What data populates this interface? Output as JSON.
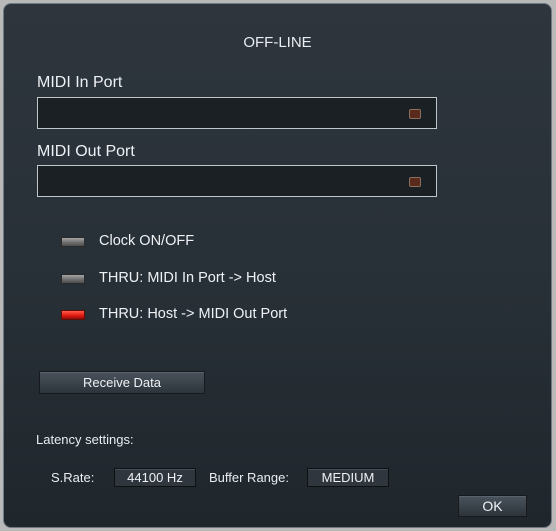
{
  "dialog": {
    "title": "OFF-LINE"
  },
  "midi_in": {
    "label": "MIDI In Port",
    "value": ""
  },
  "midi_out": {
    "label": "MIDI Out Port",
    "value": ""
  },
  "toggles": [
    {
      "label": "Clock ON/OFF",
      "state": "off"
    },
    {
      "label": "THRU: MIDI In Port -> Host",
      "state": "off"
    },
    {
      "label": "THRU: Host -> MIDI Out Port",
      "state": "on"
    }
  ],
  "receive_button": {
    "label": "Receive Data"
  },
  "latency": {
    "heading": "Latency settings:",
    "srate_label": "S.Rate:",
    "srate_value": "44100 Hz",
    "buffer_label": "Buffer Range:",
    "buffer_value": "MEDIUM"
  },
  "ok_button": {
    "label": "OK"
  },
  "colors": {
    "led_on": "#e11b12",
    "led_off": "#7a7a7a",
    "panel_bg": "#283037"
  }
}
